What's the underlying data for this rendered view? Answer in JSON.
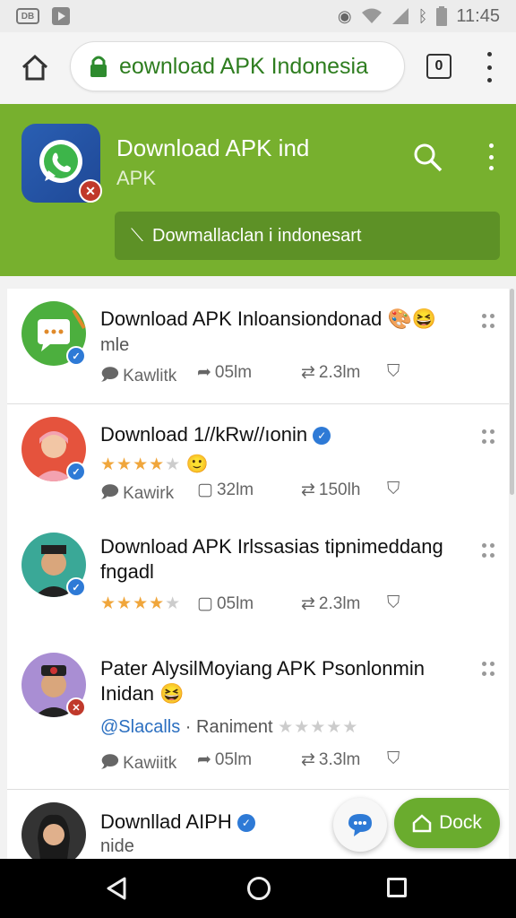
{
  "status_bar": {
    "time": "11:45",
    "sim_label": "DB"
  },
  "browser": {
    "url": "eownload APK Indonesia",
    "tabs_count": "0"
  },
  "app_header": {
    "title": "Download APK ind",
    "subtitle": "APK",
    "banner_text": "Dowmallaclan i indonesart",
    "icon_badge": "✕"
  },
  "posts": [
    {
      "title": "Download APK Inloansiondonad",
      "sub": "mle",
      "action1": "Kawlitk",
      "action2": "05lm",
      "action3": "2.3lm"
    },
    {
      "title": "Download 1//kRw//ıonin",
      "rating": 4,
      "action1": "Kawirk",
      "action2": "32lm",
      "action3": "150lh"
    },
    {
      "title": "Download APK Irlssasias tipnimeddang fngadl",
      "rating": 4,
      "action2": "05lm",
      "action3": "2.3lm"
    },
    {
      "title": "Pater AlysilMoyiang APK Psonlonmin Inidan",
      "handle": "@Slacalls",
      "handle_rest": "Raniment",
      "action1": "Kawiitk",
      "action2": "05lm",
      "action3": "3.3lm"
    },
    {
      "title": "Downllad AIPH",
      "sub": "nide"
    }
  ],
  "fab": {
    "dock_label": "Dock"
  },
  "colors": {
    "header_green": "#77b02e",
    "url_green": "#2e7d1f",
    "accent_blue": "#2e7ad6"
  }
}
